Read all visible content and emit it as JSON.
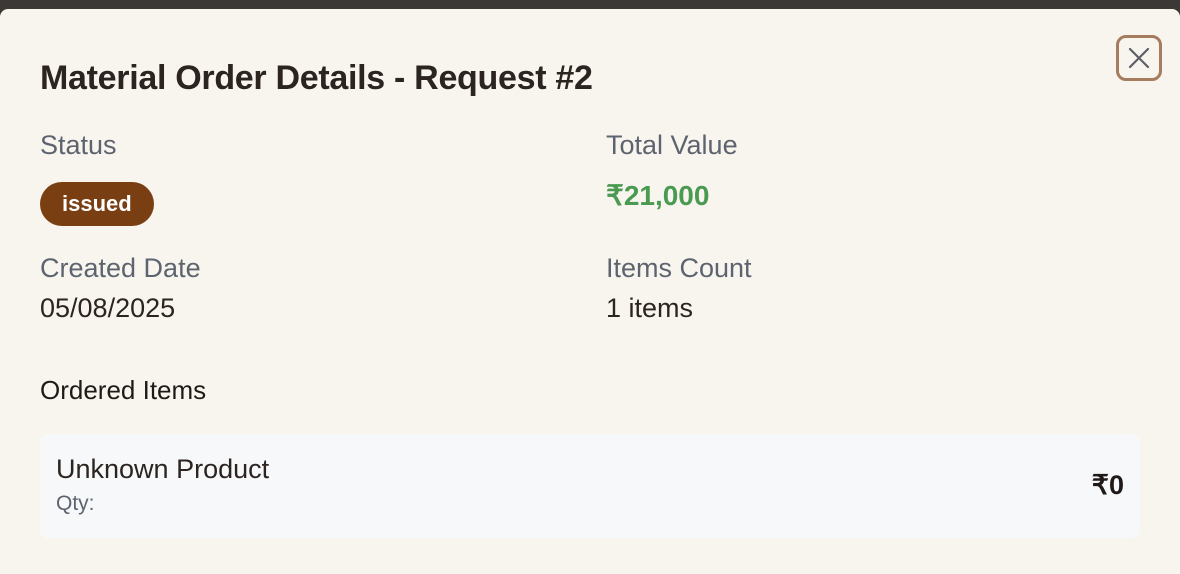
{
  "modal": {
    "title": "Material Order Details - Request #2",
    "close_icon": "close-icon"
  },
  "details": {
    "status_label": "Status",
    "status_value": "issued",
    "total_label": "Total Value",
    "total_value": "₹21,000",
    "created_label": "Created Date",
    "created_value": "05/08/2025",
    "items_count_label": "Items Count",
    "items_count_value": "1 items"
  },
  "ordered_items": {
    "section_title": "Ordered Items",
    "items": [
      {
        "name": "Unknown Product",
        "qty": "Qty:",
        "price": "₹0"
      }
    ]
  },
  "colors": {
    "modal_bg": "#f8f5ee",
    "status_badge": "#7a3e13",
    "total_value": "#4a9a52",
    "close_border": "#a67c5e"
  }
}
